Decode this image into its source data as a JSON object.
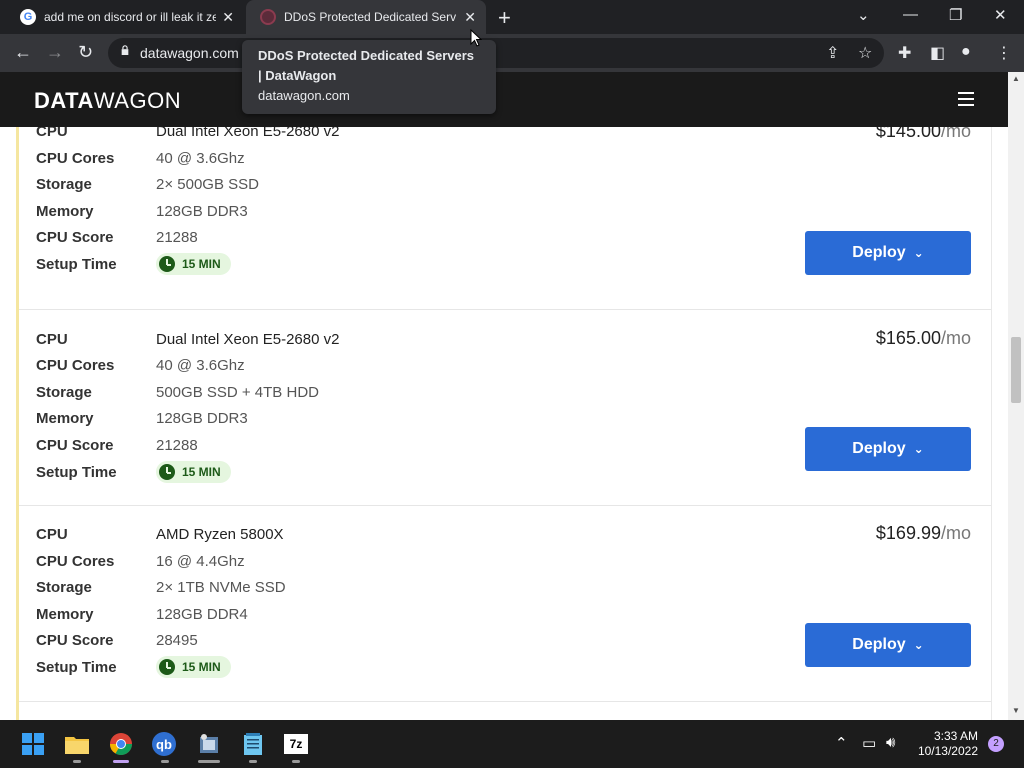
{
  "browser": {
    "tabs": [
      {
        "title": "add me on discord or ill leak it ze",
        "icon": "google-icon"
      },
      {
        "title": "DDoS Protected Dedicated Serve",
        "icon": "datawagon-favicon"
      }
    ],
    "url": "datawagon.com",
    "tooltip": {
      "title": "DDoS Protected Dedicated Servers | DataWagon",
      "domain": "datawagon.com"
    }
  },
  "site": {
    "logo_bold": "DATA",
    "logo_light": "WAGON"
  },
  "servers": [
    {
      "labels": {
        "cpu": "CPU",
        "cores": "CPU Cores",
        "storage": "Storage",
        "memory": "Memory",
        "score": "CPU Score",
        "setup": "Setup Time"
      },
      "cpu": "Dual Intel Xeon E5-2680 v2",
      "cores": "40 @ 3.6Ghz",
      "storage": "2× 500GB SSD",
      "memory": "128GB DDR3",
      "score": "21288",
      "setup": "15 MIN",
      "price": "$145.00",
      "period": "/mo",
      "deploy": "Deploy"
    },
    {
      "labels": {
        "cpu": "CPU",
        "cores": "CPU Cores",
        "storage": "Storage",
        "memory": "Memory",
        "score": "CPU Score",
        "setup": "Setup Time"
      },
      "cpu": "Dual Intel Xeon E5-2680 v2",
      "cores": "40 @ 3.6Ghz",
      "storage": "500GB SSD + 4TB HDD",
      "memory": "128GB DDR3",
      "score": "21288",
      "setup": "15 MIN",
      "price": "$165.00",
      "period": "/mo",
      "deploy": "Deploy"
    },
    {
      "labels": {
        "cpu": "CPU",
        "cores": "CPU Cores",
        "storage": "Storage",
        "memory": "Memory",
        "score": "CPU Score",
        "setup": "Setup Time"
      },
      "cpu": "AMD Ryzen 5800X",
      "cores": "16 @ 4.4Ghz",
      "storage": "2× 1TB NVMe SSD",
      "memory": "128GB DDR4",
      "score": "28495",
      "setup": "15 MIN",
      "price": "$169.99",
      "period": "/mo",
      "deploy": "Deploy"
    }
  ],
  "taskbar": {
    "apps": [
      "start-icon",
      "file-explorer-icon",
      "chrome-icon",
      "qbittorrent-icon",
      "app-icon",
      "notepad-icon",
      "7zip-icon"
    ],
    "qb_label": "qb",
    "sevenzip_label": "7z",
    "time": "3:33 AM",
    "date": "10/13/2022",
    "notifications": "2"
  },
  "colors": {
    "deploy_button": "#2a6bd6",
    "badge_bg": "#e5f6df",
    "accent_border": "#f5e6a0"
  }
}
